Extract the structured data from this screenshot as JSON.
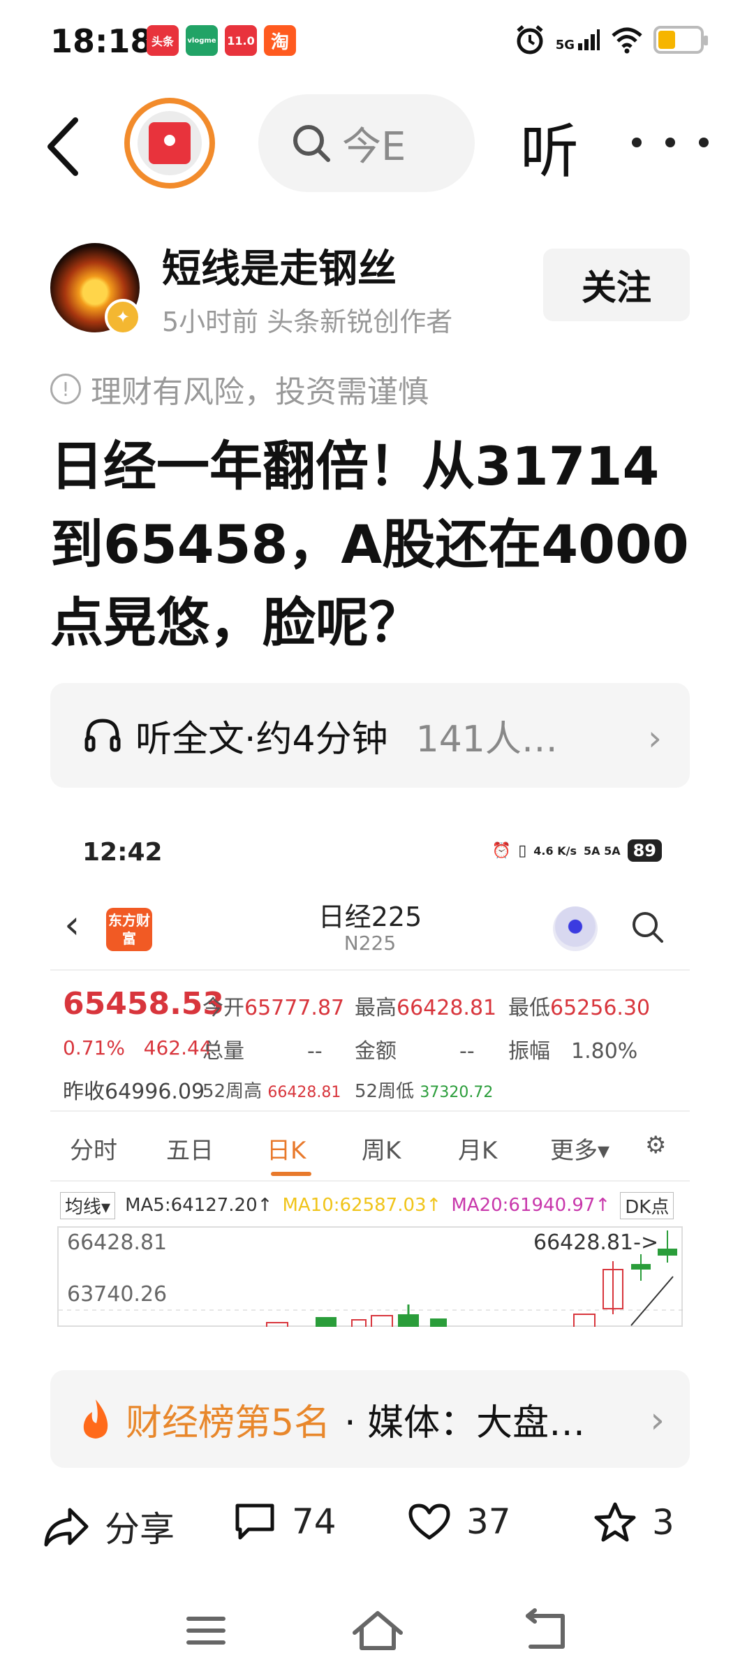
{
  "status_bar": {
    "time": "18:18",
    "notifications": [
      {
        "name": "toutiao-notif-icon",
        "text": "头条",
        "color": "#e8333c"
      },
      {
        "name": "vivo-home-notif-icon",
        "text": "vlogme",
        "color": "#21a366"
      },
      {
        "name": "app-notif-icon",
        "text": "11.0",
        "color": "#e8333c"
      },
      {
        "name": "taobao-notif-icon",
        "text": "淘",
        "color": "#ff5a1f"
      }
    ],
    "network": "5G",
    "battery_level": 0.3
  },
  "nav": {
    "search_placeholder": "今E",
    "listen_label": "听"
  },
  "author": {
    "name": "短线是走钢丝",
    "meta": "5小时前  头条新锐创作者",
    "follow_label": "关注"
  },
  "risk_notice": "理财有风险，投资需谨慎",
  "article": {
    "title": "日经一年翻倍！从31714到65458，A股还在4000点晃悠，脸呢？"
  },
  "listen_bar": {
    "label": "听全文·约4分钟",
    "count": "141人…"
  },
  "embedded_screenshot": {
    "time": "12:42",
    "net_speed": "4.6 K/s",
    "signal": "5A 5A",
    "battery": "89",
    "app_logo": "东方财富",
    "index_name": "日经225",
    "index_code": "N225",
    "price": "65458.53",
    "change_pct": "0.71%",
    "change_abs": "462.44",
    "prev_close_label": "昨收",
    "prev_close": "64996.09",
    "open_label": "今开",
    "open": "65777.87",
    "high_label": "最高",
    "high": "66428.81",
    "low_label": "最低",
    "low": "65256.30",
    "volume_label": "总量",
    "volume": "--",
    "amount_label": "金额",
    "amount": "--",
    "amplitude_label": "振幅",
    "amplitude": "1.80%",
    "wk52_high_label": "52周高",
    "wk52_high": "66428.81",
    "wk52_low_label": "52周低",
    "wk52_low": "37320.72",
    "tabs": [
      "分时",
      "五日",
      "日K",
      "周K",
      "月K",
      "更多▾"
    ],
    "active_tab": "日K",
    "ma_mode": "均线▾",
    "ma5": "MA5:64127.20↑",
    "ma10": "MA10:62587.03↑",
    "ma20": "MA20:61940.97↑",
    "dk_label": "DK点",
    "axis_top": "66428.81",
    "axis_mid": "63740.26",
    "max_marker": "66428.81->",
    "colors": {
      "up": "#d8353c",
      "down": "#2a9d3a",
      "ma5": "#333333",
      "ma10": "#f0c419",
      "ma20": "#c837ab"
    }
  },
  "rank_bar": {
    "rank": "财经榜第5名",
    "media": "· 媒体：大盘…"
  },
  "actions": {
    "share": "分享",
    "comments": "74",
    "likes": "37",
    "favorites": "3"
  }
}
